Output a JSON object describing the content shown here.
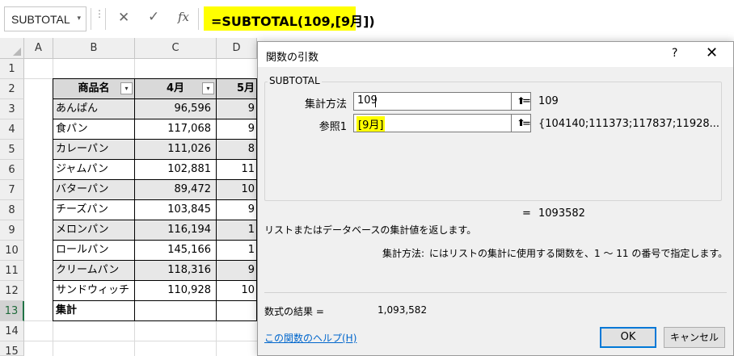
{
  "formula_bar": {
    "name_box": "SUBTOTAL",
    "name_box_arrow": "▾",
    "dots": "⋮",
    "cancel_icon": "✕",
    "enter_icon": "✓",
    "fx_icon": "fx",
    "formula": "=SUBTOTAL(109,[9月])",
    "highlight_color": "#ffff00"
  },
  "grid": {
    "columns": [
      "A",
      "B",
      "C",
      "D"
    ],
    "rows": [
      "1",
      "2",
      "3",
      "4",
      "5",
      "6",
      "7",
      "8",
      "9",
      "10",
      "11",
      "12",
      "13",
      "14",
      "15"
    ],
    "selected_row": "13"
  },
  "table": {
    "headers": [
      "商品名",
      "4月",
      "5月"
    ],
    "filter_icon": "▾",
    "rows": [
      {
        "name": "あんぱん",
        "apr": "96,596",
        "may": "9"
      },
      {
        "name": "食パン",
        "apr": "117,068",
        "may": "9"
      },
      {
        "name": "カレーパン",
        "apr": "111,026",
        "may": "8"
      },
      {
        "name": "ジャムパン",
        "apr": "102,881",
        "may": "11"
      },
      {
        "name": "バターパン",
        "apr": "89,472",
        "may": "10"
      },
      {
        "name": "チーズパン",
        "apr": "103,845",
        "may": "9"
      },
      {
        "name": "メロンパン",
        "apr": "116,194",
        "may": "1"
      },
      {
        "name": "ロールパン",
        "apr": "145,166",
        "may": "1"
      },
      {
        "name": "クリームパン",
        "apr": "118,316",
        "may": "9"
      },
      {
        "name": "サンドウィッチ",
        "apr": "110,928",
        "may": "10"
      }
    ],
    "total_label": "集計"
  },
  "dialog": {
    "title": "関数の引数",
    "help_icon": "?",
    "close_icon": "✕",
    "function_name": "SUBTOTAL",
    "args": [
      {
        "label": "集計方法",
        "value": "109",
        "eq": "=",
        "result": "109"
      },
      {
        "label": "参照1",
        "value": "[9月]",
        "eq": "=",
        "result": "{104140;111373;117837;11928..."
      }
    ],
    "ref_icon": "⬆",
    "total_eq": "=",
    "total_value": "1093582",
    "description": "リストまたはデータベースの集計値を返します。",
    "arg_desc_label": "集計方法:",
    "arg_desc_text": "にはリストの集計に使用する関数を、1 〜 11 の番号で指定します。",
    "result_label": "数式の結果 =",
    "result_value": "1,093,582",
    "help_link": "この関数のヘルプ(H)",
    "ok_label": "OK",
    "cancel_label": "キャンセル",
    "ok_border_color": "#0078d7"
  }
}
